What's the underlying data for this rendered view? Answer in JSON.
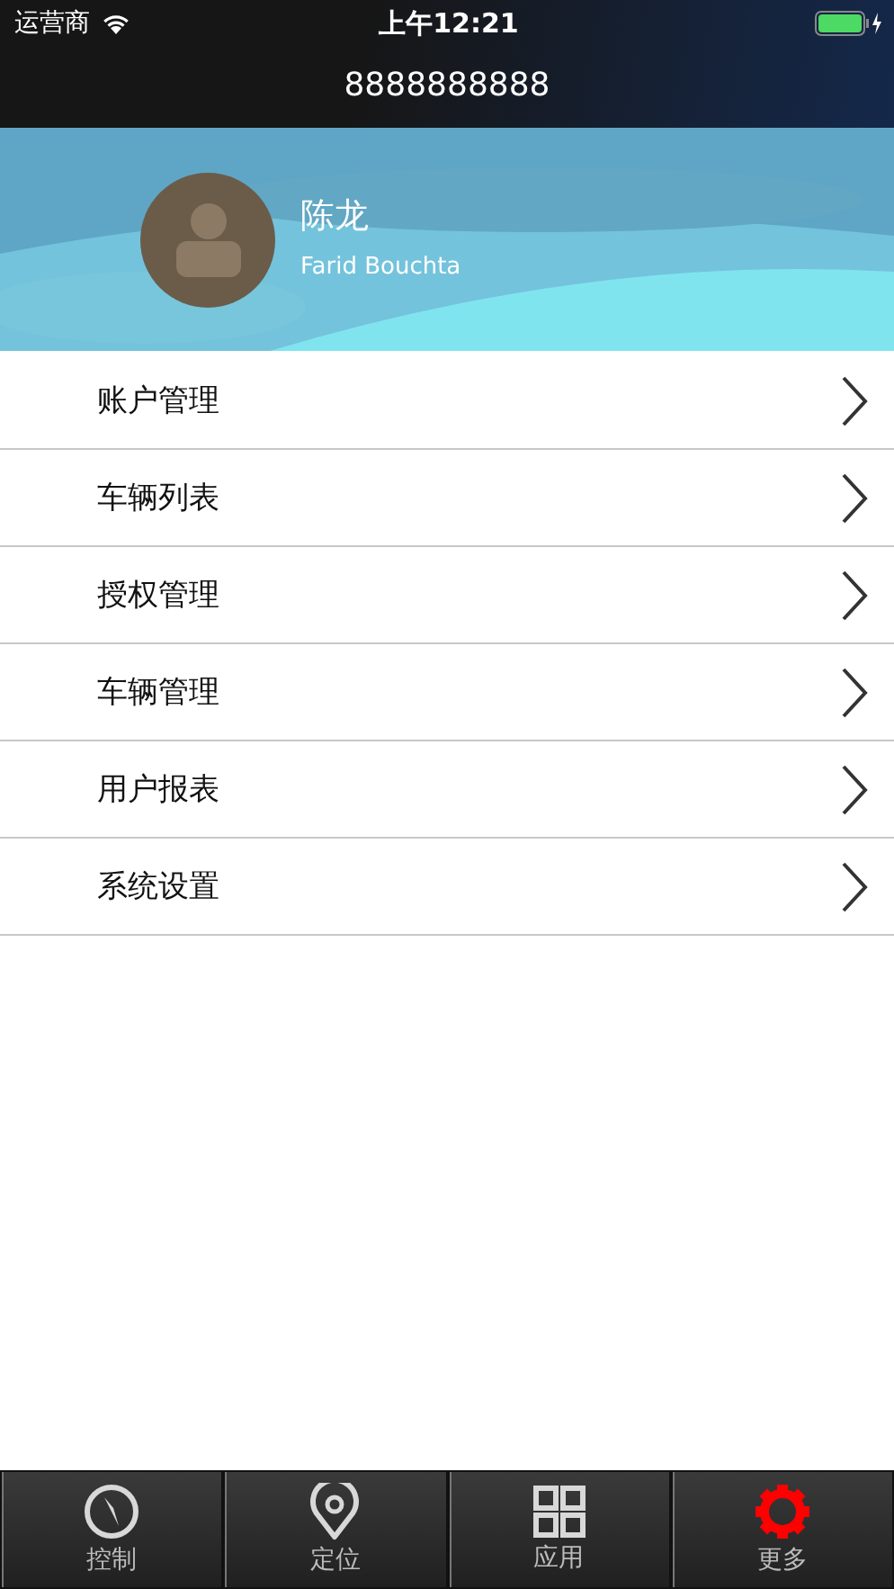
{
  "status_bar": {
    "carrier": "运营商",
    "time": "上午12:21"
  },
  "title": "8888888888",
  "profile": {
    "name": "陈龙",
    "subtitle": "Farid Bouchta"
  },
  "menu": [
    {
      "label": "账户管理"
    },
    {
      "label": "车辆列表"
    },
    {
      "label": "授权管理"
    },
    {
      "label": "车辆管理"
    },
    {
      "label": "用户报表"
    },
    {
      "label": "系统设置"
    }
  ],
  "tabs": [
    {
      "kind": "compass",
      "label": "控制",
      "selected": false
    },
    {
      "kind": "pin",
      "label": "定位",
      "selected": false
    },
    {
      "kind": "grid",
      "label": "应用",
      "selected": false
    },
    {
      "kind": "gear",
      "label": "更多",
      "selected": true
    }
  ]
}
